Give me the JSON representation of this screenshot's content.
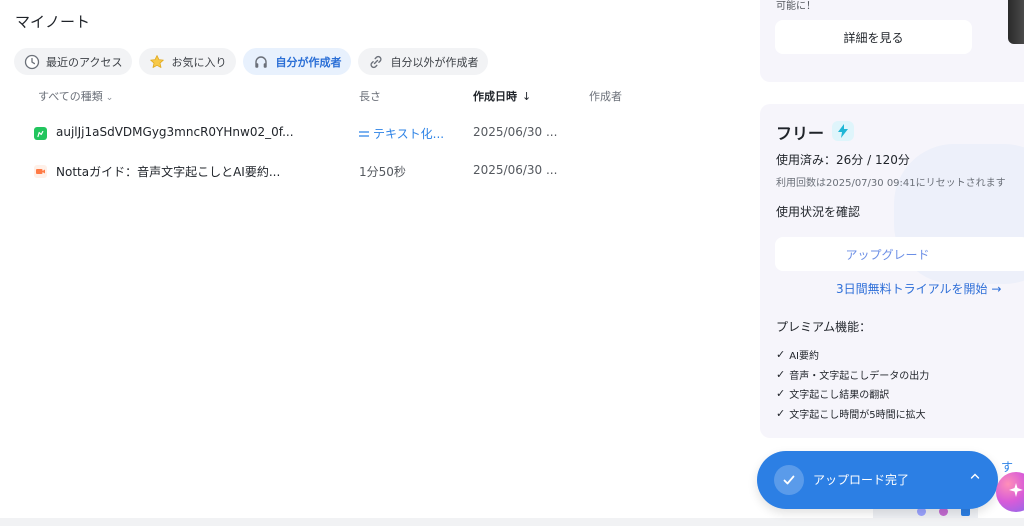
{
  "page": {
    "title": "マイノート"
  },
  "filters": [
    {
      "label": "最近のアクセス",
      "icon": "clock-icon",
      "active": false
    },
    {
      "label": "お気に入り",
      "icon": "star-icon",
      "active": false
    },
    {
      "label": "自分が作成者",
      "icon": "headphones-icon",
      "active": true
    },
    {
      "label": "自分以外が作成者",
      "icon": "link-icon",
      "active": false
    }
  ],
  "table": {
    "headers": {
      "type": "すべての種類",
      "length": "長さ",
      "date": "作成日時",
      "creator": "作成者"
    },
    "rows": [
      {
        "name": "aujlJj1aSdVDMGyg3mncR0YHnw02_0f...",
        "length": "テキスト化...",
        "date": "2025/06/30 ...",
        "icon": "green-audio-file-icon",
        "icon_color": "#22c55e"
      },
      {
        "name": "Nottaガイド：音声文字起こしとAI要約...",
        "length": "1分50秒",
        "date": "2025/06/30 ...",
        "icon": "orange-video-file-icon",
        "icon_color": "#ff7a45"
      }
    ]
  },
  "promo": {
    "small_text": "可能に！",
    "detail_button": "詳細を見る"
  },
  "plan": {
    "name": "フリー",
    "usage": "使用済み：26分 / 120分",
    "reset": "利用回数は2025/07/30 09:41にリセットされます",
    "check_usage": "使用状況を確認",
    "upgrade": "アップグレード",
    "trial": "3日間無料トライアルを開始 →",
    "premium_title": "プレミアム機能：",
    "features": [
      "AI要約",
      "音声・文字起こしデータの出力",
      "文字起こし結果の翻訳",
      "文字起こし時間が5時間に拡大"
    ]
  },
  "toast": {
    "message": "アップロード完了",
    "peek": "す"
  },
  "colors": {
    "accent": "#2c7fe4",
    "link": "#2e83e6",
    "panel_bg": "#f6f5fb"
  }
}
